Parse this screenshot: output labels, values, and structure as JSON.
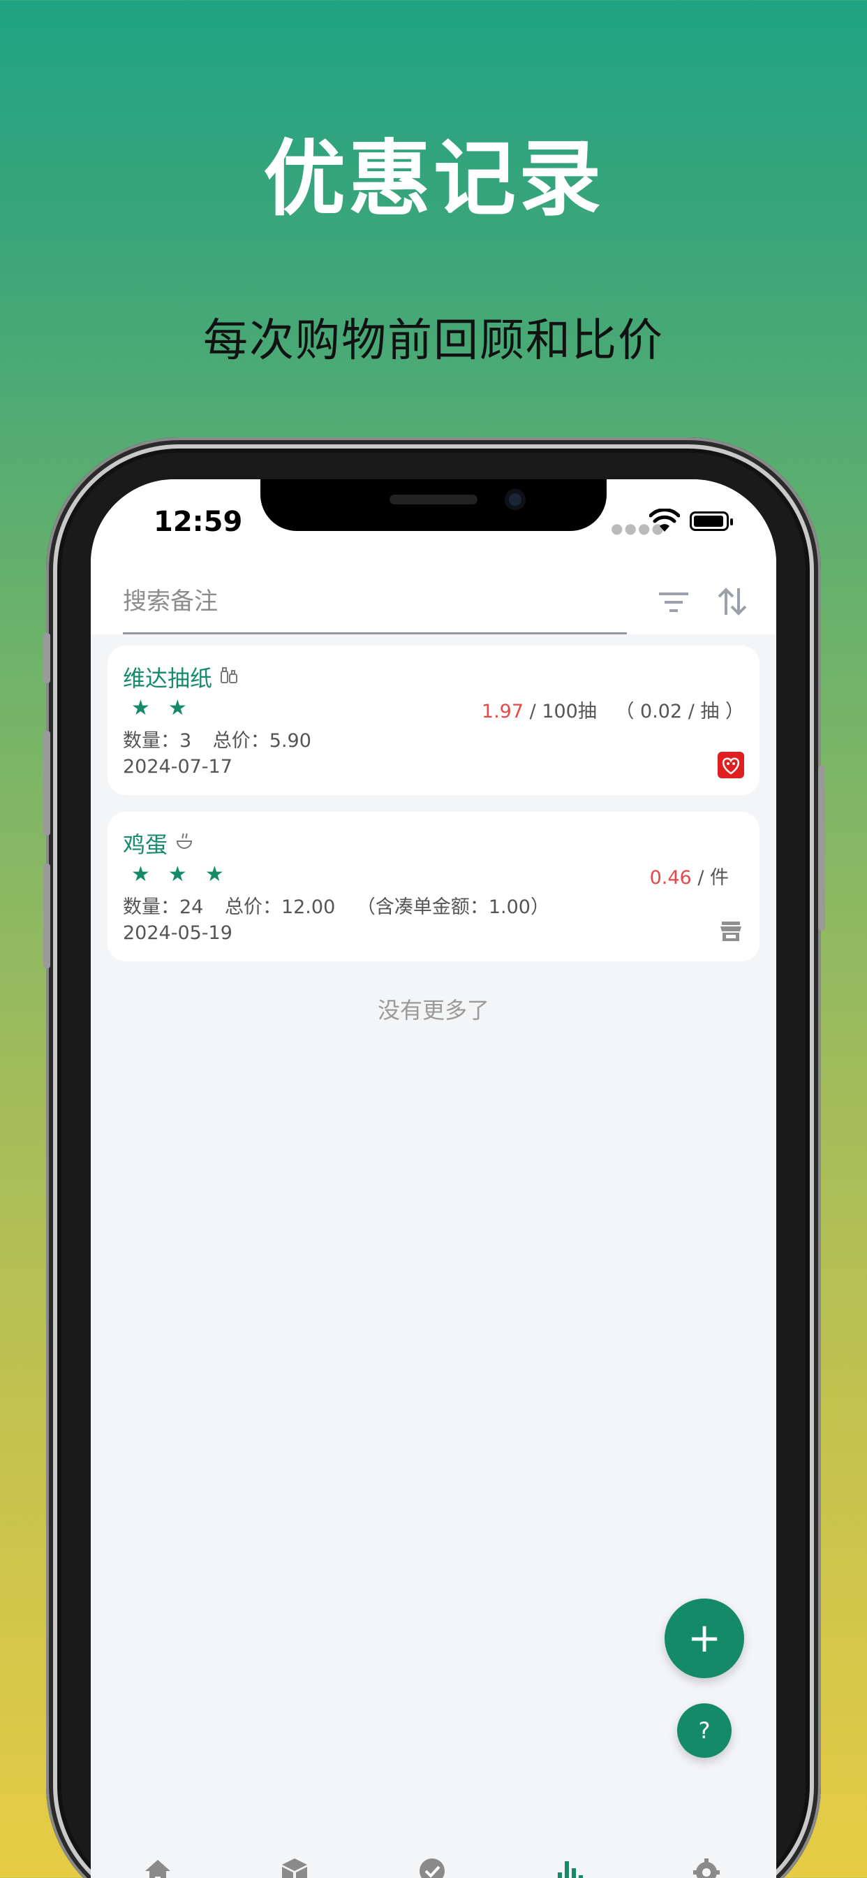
{
  "headline": "优惠记录",
  "subheadline": "每次购物前回顾和比价",
  "status_bar": {
    "time": "12:59"
  },
  "search": {
    "placeholder": "搜索备注"
  },
  "records": [
    {
      "name": "维达抽纸",
      "category_icon": "bottles-icon",
      "rating": 2,
      "unit_price": "1.97",
      "unit": "/ 100抽",
      "per_item_price": "（ 0.02 / 抽 ）",
      "quantity_label": "数量：3",
      "total_label": "总价：5.90",
      "extra_label": "",
      "date": "2024-07-17",
      "store_icon": "pinduoduo-icon"
    },
    {
      "name": "鸡蛋",
      "category_icon": "cooking-bowl-icon",
      "rating": 3,
      "unit_price": "0.46",
      "unit": "/ 件",
      "per_item_price": "",
      "quantity_label": "数量：24",
      "total_label": "总价：12.00",
      "extra_label": "（含凑单金额：1.00）",
      "date": "2024-05-19",
      "store_icon": "store-icon"
    }
  ],
  "list_end_text": "没有更多了",
  "fab": {
    "add_label": "+",
    "help_label": "?"
  },
  "tabs": [
    {
      "icon": "home-icon"
    },
    {
      "icon": "box-icon"
    },
    {
      "icon": "check-circle-icon"
    },
    {
      "icon": "bar-chart-icon",
      "active": true
    },
    {
      "icon": "gear-icon"
    }
  ],
  "colors": {
    "accent": "#148a68",
    "price_highlight": "#e24a4a",
    "gradient_top": "#1ea383",
    "gradient_bottom": "#e6cc44"
  }
}
